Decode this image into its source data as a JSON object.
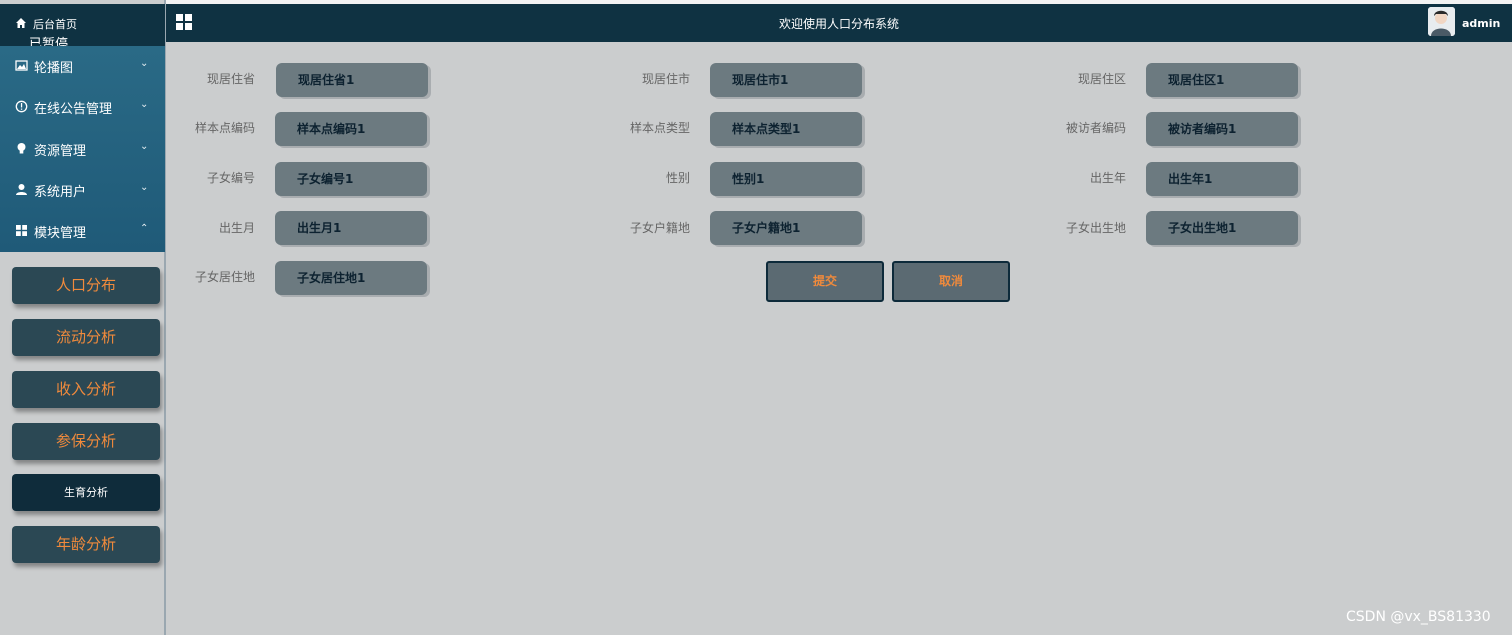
{
  "sidebar": {
    "home_label": "后台首页",
    "paused_label": "已暂停",
    "menu": [
      {
        "label": "轮播图",
        "icon": "image-icon",
        "chevron": "⌄"
      },
      {
        "label": "在线公告管理",
        "icon": "info-circle-icon",
        "chevron": "⌄"
      },
      {
        "label": "资源管理",
        "icon": "lightbulb-icon",
        "chevron": "⌄"
      },
      {
        "label": "系统用户",
        "icon": "user-icon",
        "chevron": "⌄"
      },
      {
        "label": "模块管理",
        "icon": "grid-icon",
        "chevron": "⌃"
      }
    ],
    "submenu": [
      {
        "label": "人口分布"
      },
      {
        "label": "流动分析"
      },
      {
        "label": "收入分析"
      },
      {
        "label": "参保分析"
      },
      {
        "label": "生育分析",
        "active": true
      },
      {
        "label": "年龄分析"
      }
    ]
  },
  "header": {
    "title": "欢迎使用人口分布系统",
    "user": "admin"
  },
  "form": {
    "fields": [
      {
        "label": "现居住省",
        "value": "现居住省1"
      },
      {
        "label": "现居住市",
        "value": "现居住市1"
      },
      {
        "label": "现居住区",
        "value": "现居住区1"
      },
      {
        "label": "样本点编码",
        "value": "样本点编码1"
      },
      {
        "label": "样本点类型",
        "value": "样本点类型1"
      },
      {
        "label": "被访者编码",
        "value": "被访者编码1"
      },
      {
        "label": "子女编号",
        "value": "子女编号1"
      },
      {
        "label": "性别",
        "value": "性别1"
      },
      {
        "label": "出生年",
        "value": "出生年1"
      },
      {
        "label": "出生月",
        "value": "出生月1"
      },
      {
        "label": "子女户籍地",
        "value": "子女户籍地1"
      },
      {
        "label": "子女出生地",
        "value": "子女出生地1"
      },
      {
        "label": "子女居住地",
        "value": "子女居住地1"
      }
    ],
    "submit_label": "提交",
    "cancel_label": "取消"
  },
  "watermark": "CSDN @vx_BS81330",
  "colors": {
    "sidebar_menu": "#1f5a78",
    "header": "#0f3242",
    "accent": "#f08a3c",
    "field_bg": "#6c7a80",
    "page_bg": "#cbcdce"
  }
}
